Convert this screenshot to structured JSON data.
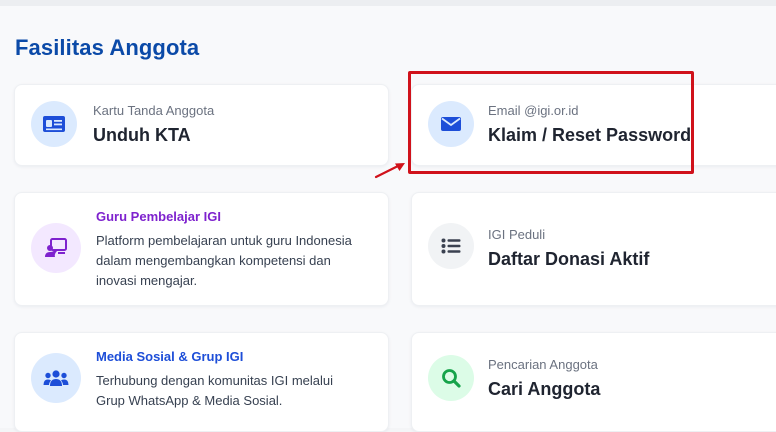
{
  "section": {
    "title": "Fasilitas Anggota"
  },
  "cards": {
    "kta": {
      "label": "Kartu Tanda Anggota",
      "title": "Unduh KTA",
      "icon": "id-card-icon"
    },
    "email": {
      "label": "Email @igi.or.id",
      "title": "Klaim / Reset Password",
      "icon": "envelope-icon"
    },
    "guru": {
      "title": "Guru Pembelajar IGI",
      "desc_lines": [
        "Platform pembelajaran untuk guru Indonesia",
        "dalam mengembangkan kompetensi dan",
        "inovasi mengajar."
      ],
      "icon": "teacher-board-icon"
    },
    "peduli": {
      "label": "IGI Peduli",
      "title": "Daftar Donasi Aktif",
      "icon": "list-icon"
    },
    "media": {
      "title": "Media Sosial & Grup IGI",
      "desc_lines": [
        "Terhubung dengan komunitas IGI melalui",
        "Grup WhatsApp & Media Sosial."
      ],
      "icon": "users-group-icon"
    },
    "cari": {
      "label": "Pencarian Anggota",
      "title": "Cari Anggota",
      "icon": "search-icon"
    }
  },
  "colors": {
    "accent": "#0b4aa8",
    "highlight": "#d0121b",
    "purple": "#7e22ce",
    "blue_link": "#1d4ed8",
    "green": "#16a34a"
  }
}
